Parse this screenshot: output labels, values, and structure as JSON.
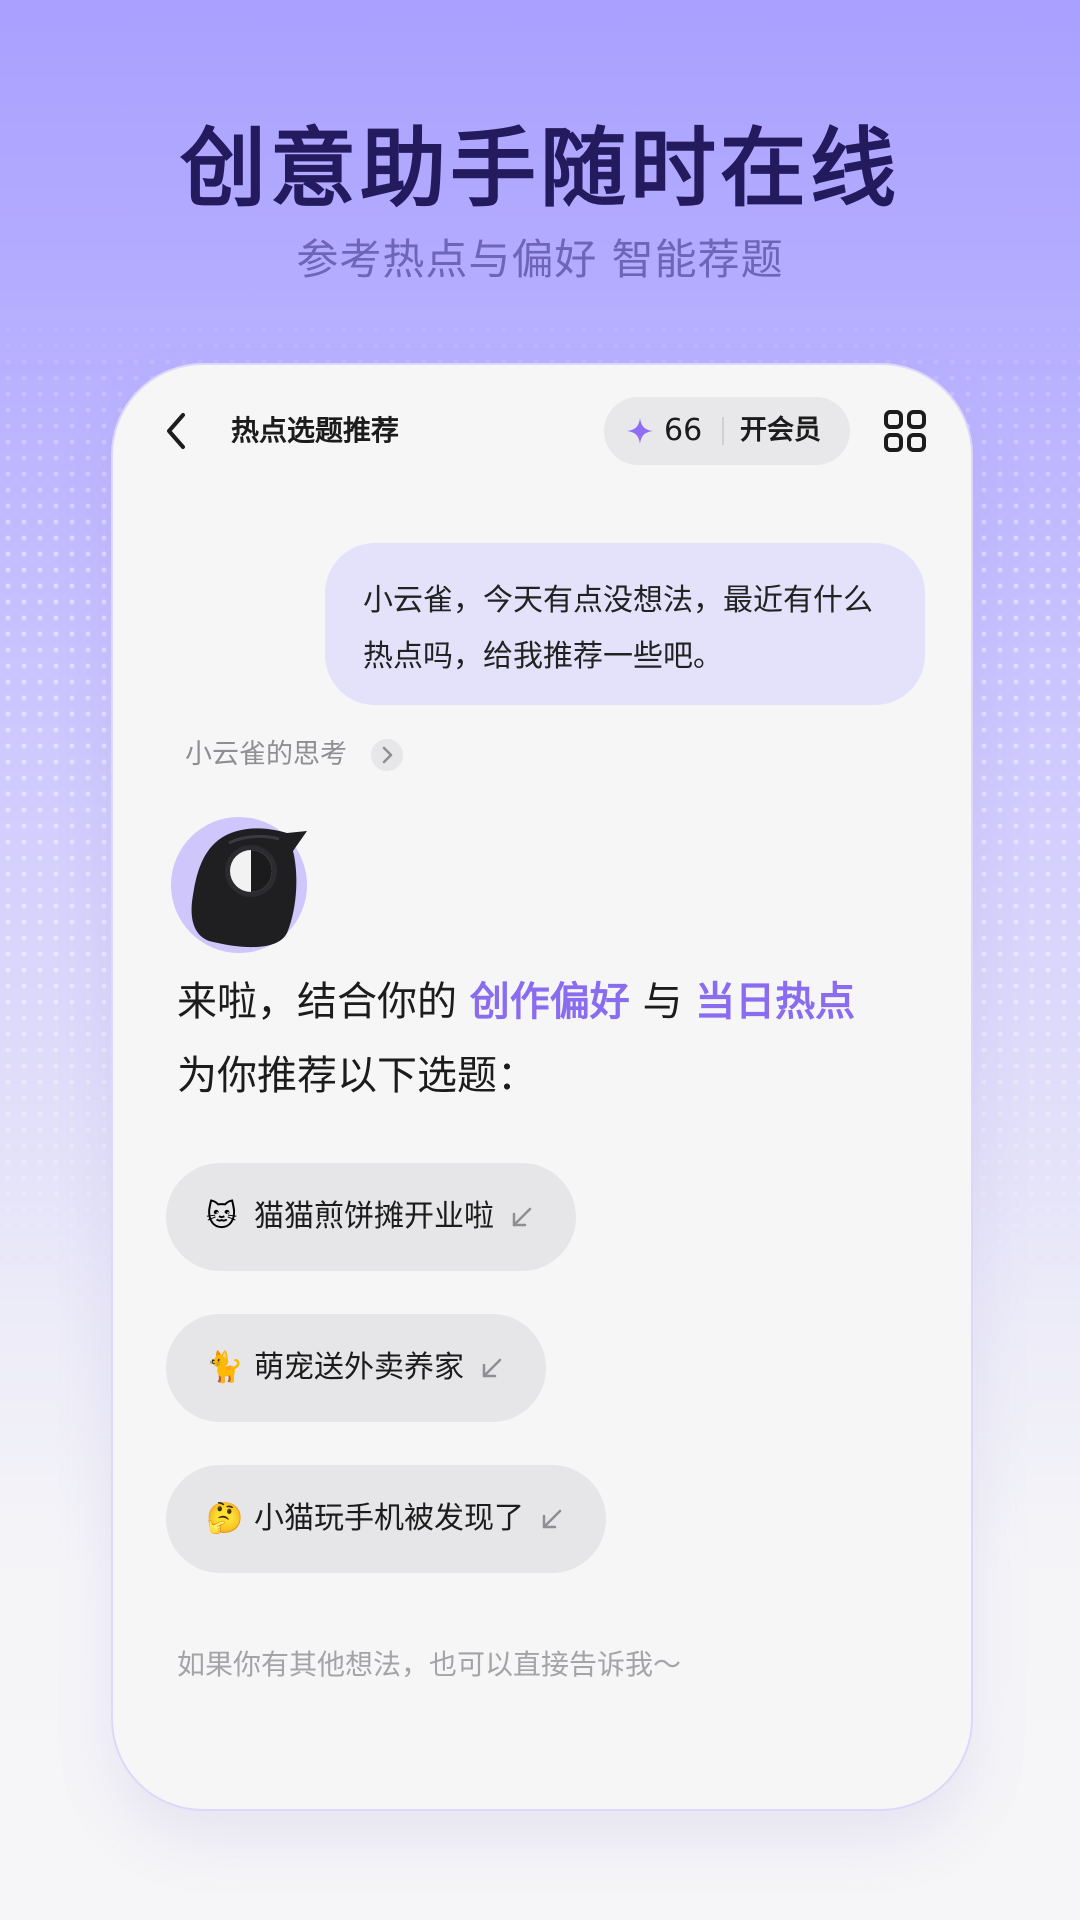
{
  "hero": {
    "title": "创意助手随时在线",
    "subtitle": "参考热点与偏好 智能荐题"
  },
  "topbar": {
    "back_icon": "chevron-left-icon",
    "title": "热点选题推荐",
    "points": "66",
    "vip_label": "开会员",
    "apps_icon": "apps-grid-icon"
  },
  "chat": {
    "user_message": "小云雀，今天有点没想法，最近有什么热点吗，给我推荐一些吧。",
    "thinking_label": "小云雀的思考",
    "reply": {
      "part1": "来啦，结合你的",
      "highlight1": "创作偏好",
      "part2": "与",
      "highlight2": "当日热点",
      "line2": "为你推荐以下选题："
    },
    "topics": [
      {
        "emoji": "🐱",
        "label": "猫猫煎饼摊开业啦"
      },
      {
        "emoji": "🐈",
        "label": "萌宠送外卖养家"
      },
      {
        "emoji": "🤔",
        "label": "小猫玩手机被发现了"
      }
    ],
    "footer_hint": "如果你有其他想法，也可以直接告诉我～"
  },
  "colors": {
    "accent": "#8a6cf0",
    "bubble": "#e4e2fb",
    "chip": "#e6e6e8"
  }
}
